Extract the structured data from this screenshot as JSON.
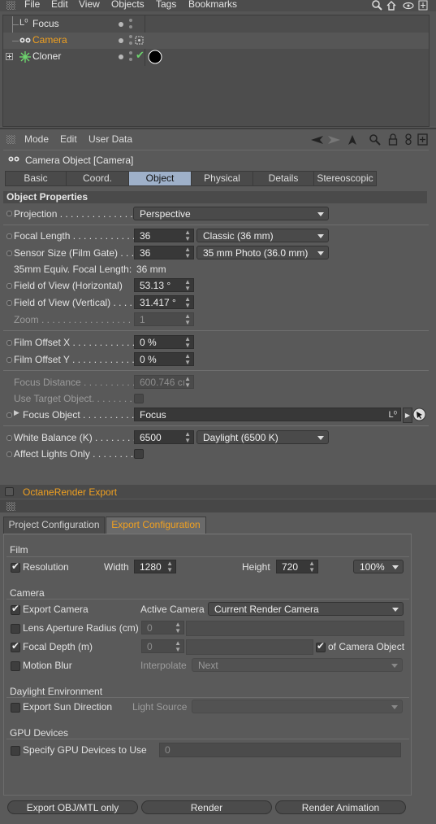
{
  "object_manager": {
    "menu": [
      "File",
      "Edit",
      "View",
      "Objects",
      "Tags",
      "Bookmarks"
    ],
    "objects": [
      {
        "name": "Focus",
        "icon": "null-object-icon"
      },
      {
        "name": "Camera",
        "icon": "camera-icon",
        "selected": true
      },
      {
        "name": "Cloner",
        "icon": "cloner-icon"
      }
    ]
  },
  "attributes": {
    "menu": [
      "Mode",
      "Edit",
      "User Data"
    ],
    "title": "Camera Object [Camera]",
    "tabs": [
      "Basic",
      "Coord.",
      "Object",
      "Physical",
      "Details",
      "Stereoscopic"
    ],
    "active_tab": "Object",
    "section_title": "Object Properties",
    "projection": {
      "label": "Projection . . . . . . . . . . . . . .",
      "value": "Perspective"
    },
    "focal_length": {
      "label": "Focal Length . . . . . . . . . . . .",
      "value": "36",
      "preset": "Classic (36 mm)"
    },
    "sensor_size": {
      "label": "Sensor Size (Film Gate) . . . .",
      "value": "36",
      "preset": "35 mm Photo (36.0 mm)"
    },
    "equiv_focal": {
      "label": "35mm Equiv. Focal Length:",
      "value": "36 mm"
    },
    "fov_h": {
      "label": "Field of View (Horizontal)",
      "value": "53.13 °"
    },
    "fov_v": {
      "label": "Field of View (Vertical) . . . .",
      "value": "31.417 °"
    },
    "zoom": {
      "label": "Zoom . . . . . . . . . . . . . . . . . .",
      "value": "1"
    },
    "film_offset_x": {
      "label": "Film Offset X . . . . . . . . . . . .",
      "value": "0 %"
    },
    "film_offset_y": {
      "label": "Film Offset Y . . . . . . . . . . . .",
      "value": "0 %"
    },
    "focus_distance": {
      "label": "Focus Distance . . . . . . . . . . .",
      "value": "600.746 cı"
    },
    "use_target": {
      "label": "Use Target Object. . . . . . . ."
    },
    "focus_object": {
      "label": "Focus Object . . . . . . . . . .",
      "value": "Focus"
    },
    "white_balance": {
      "label": "White Balance (K) . . . . . . . .",
      "value": "6500",
      "preset": "Daylight (6500 K)"
    },
    "affect_lights": {
      "label": "Affect Lights Only . . . . . . . ."
    }
  },
  "octane": {
    "title": "OctaneRender Export",
    "tabs": [
      "Project Configuration",
      "Export Configuration"
    ],
    "active_tab": "Export Configuration",
    "film": {
      "section": "Film",
      "resolution_label": "Resolution",
      "width_label": "Width",
      "width_value": "1280",
      "height_label": "Height",
      "height_value": "720",
      "scale": "100%"
    },
    "camera": {
      "section": "Camera",
      "export_camera": "Export Camera",
      "active_camera_label": "Active Camera",
      "active_camera_value": "Current Render Camera",
      "lens_aperture": "Lens Aperture Radius (cm)",
      "lens_aperture_value": "0",
      "focal_depth": "Focal Depth (m)",
      "focal_depth_value": "0",
      "of_camera_object": "of Camera Object",
      "motion_blur": "Motion Blur",
      "interpolate_label": "Interpolate",
      "interpolate_value": "Next"
    },
    "daylight": {
      "section": "Daylight Environment",
      "export_sun": "Export Sun Direction",
      "light_source_label": "Light Source"
    },
    "gpu": {
      "section": "GPU Devices",
      "specify": "Specify GPU Devices to Use",
      "value": "0"
    },
    "buttons": [
      "Export OBJ/MTL only",
      "Render",
      "Render Animation"
    ]
  },
  "colors": {
    "accent_orange": "#f0a020",
    "active_tab_blue": "#9eb0c9"
  }
}
